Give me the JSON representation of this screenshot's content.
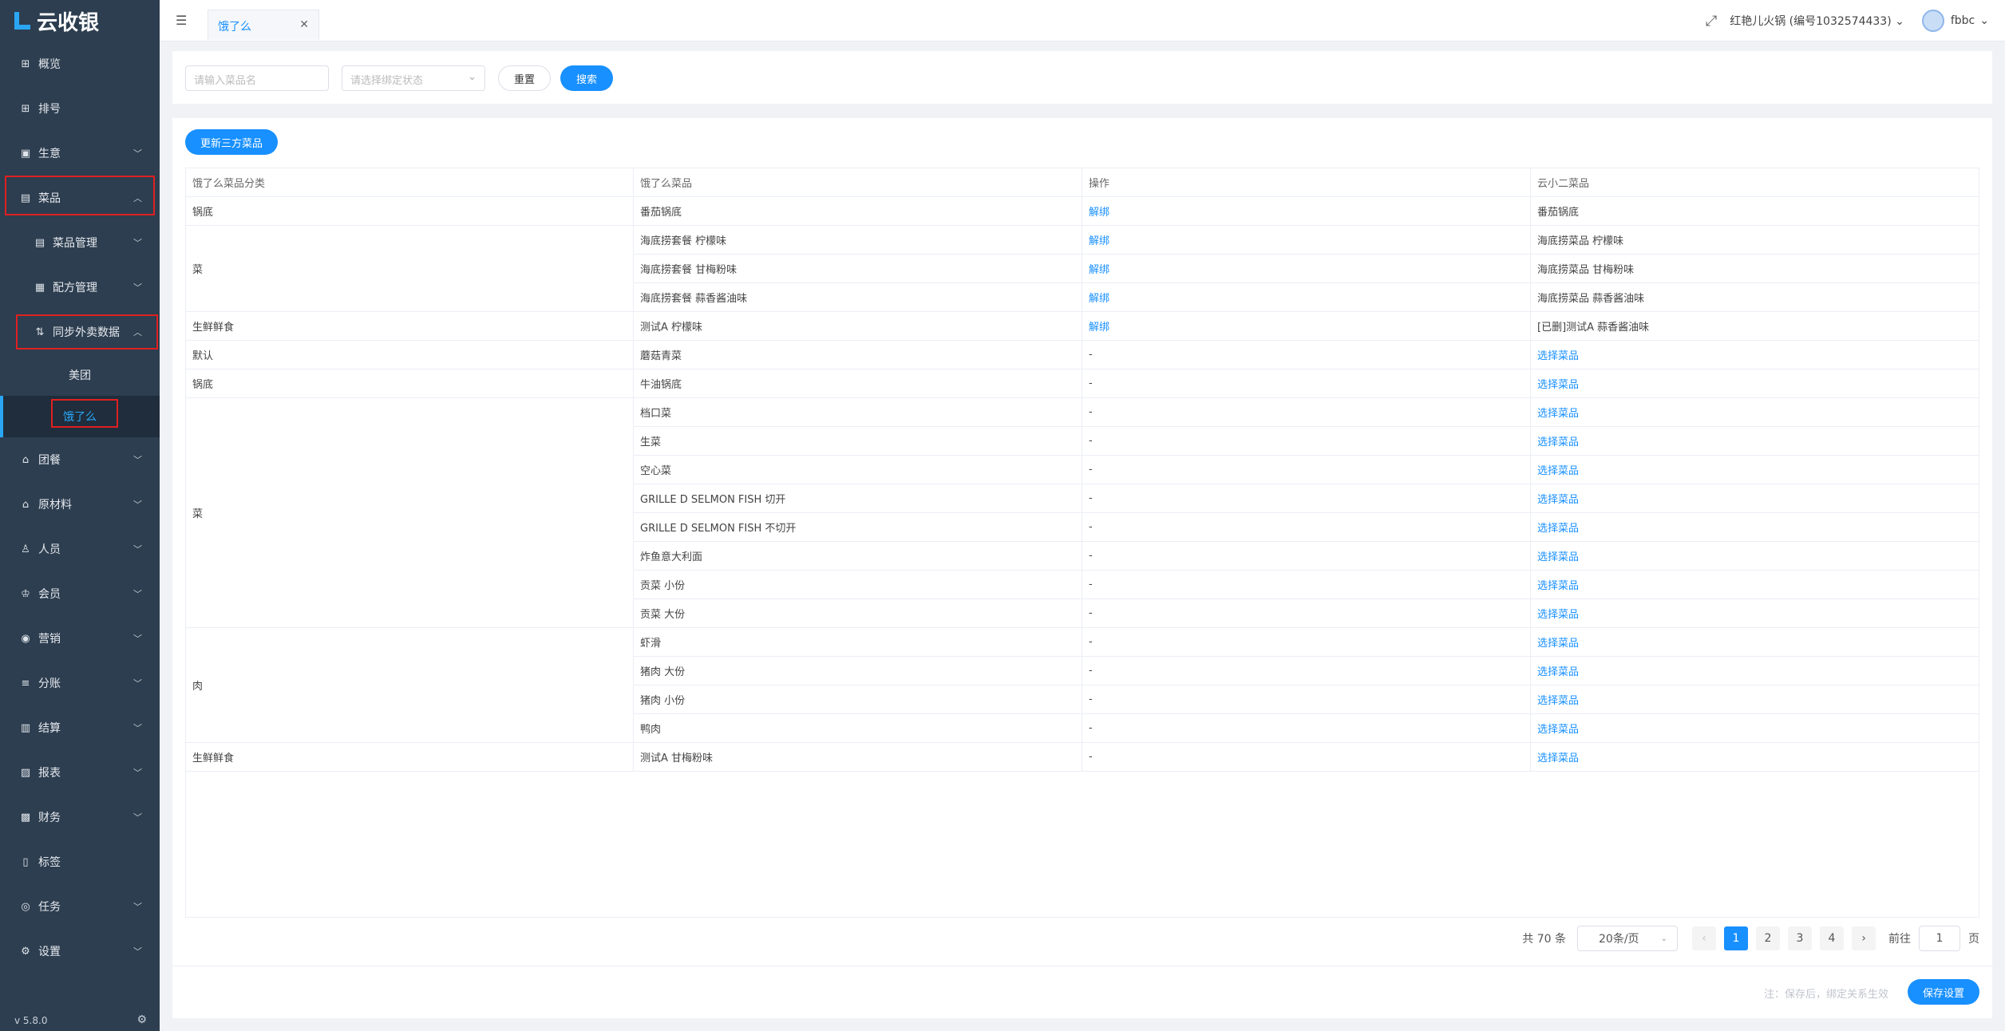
{
  "app": {
    "title": "云收银",
    "version": "v 5.8.0"
  },
  "sidebar": {
    "items": [
      {
        "label": "概览",
        "icon": "overview-icon",
        "glyph": "⊞"
      },
      {
        "label": "排号",
        "icon": "queue-icon",
        "glyph": "⊞"
      },
      {
        "label": "生意",
        "icon": "business-icon",
        "glyph": "▣"
      },
      {
        "label": "菜品",
        "icon": "dish-icon",
        "glyph": "▤"
      },
      {
        "label": "菜品管理",
        "icon": "dish-manage-icon",
        "glyph": "▤"
      },
      {
        "label": "配方管理",
        "icon": "recipe-icon",
        "glyph": "▦"
      },
      {
        "label": "同步外卖数据",
        "icon": "sync-icon",
        "glyph": "⇅"
      },
      {
        "label": "美团"
      },
      {
        "label": "饿了么"
      },
      {
        "label": "团餐",
        "icon": "group-meal-icon",
        "glyph": "⌂"
      },
      {
        "label": "原材料",
        "icon": "material-icon",
        "glyph": "⌂"
      },
      {
        "label": "人员",
        "icon": "staff-icon",
        "glyph": "♙"
      },
      {
        "label": "会员",
        "icon": "member-icon",
        "glyph": "♔"
      },
      {
        "label": "营销",
        "icon": "marketing-icon",
        "glyph": "◉"
      },
      {
        "label": "分账",
        "icon": "split-icon",
        "glyph": "≡"
      },
      {
        "label": "结算",
        "icon": "settle-icon",
        "glyph": "▥"
      },
      {
        "label": "报表",
        "icon": "report-icon",
        "glyph": "▨"
      },
      {
        "label": "财务",
        "icon": "finance-icon",
        "glyph": "▩"
      },
      {
        "label": "标签",
        "icon": "tag-icon",
        "glyph": "▯"
      },
      {
        "label": "任务",
        "icon": "task-icon",
        "glyph": "◎"
      },
      {
        "label": "设置",
        "icon": "settings-icon",
        "glyph": "⚙"
      }
    ]
  },
  "header": {
    "tab_label": "饿了么",
    "store": "红艳儿火锅 (编号1032574433)",
    "user": "fbbc"
  },
  "filters": {
    "dish_placeholder": "请输入菜品名",
    "status_placeholder": "请选择绑定状态",
    "reset_label": "重置",
    "search_label": "搜索"
  },
  "main": {
    "update_button": "更新三方菜品",
    "columns": [
      "饿了么菜品分类",
      "饿了么菜品",
      "操作",
      "云小二菜品"
    ],
    "categories": [
      "锅底",
      "菜",
      "生鲜鲜食",
      "默认",
      "锅底",
      "菜",
      "肉",
      "生鲜鲜食"
    ],
    "dishes": [
      "番茄锅底",
      "海底捞套餐 柠檬味",
      "海底捞套餐 甘梅粉味",
      "海底捞套餐 蒜香酱油味",
      "测试A 柠檬味",
      "蘑菇青菜",
      "牛油锅底",
      "档口菜",
      "生菜",
      "空心菜",
      "GRILLE D SELMON FISH 切开",
      "GRILLE D SELMON FISH 不切开",
      "炸鱼意大利面",
      "贡菜 小份",
      "贡菜 大份",
      "虾滑",
      "猪肉 大份",
      "猪肉 小份",
      "鸭肉",
      "测试A 甘梅粉味"
    ],
    "operations": [
      "解绑",
      "解绑",
      "解绑",
      "解绑",
      "解绑",
      "-",
      "-",
      "-",
      "-",
      "-",
      "-",
      "-",
      "-",
      "-",
      "-",
      "-",
      "-",
      "-",
      "-",
      "-"
    ],
    "yun_dishes": [
      "番茄锅底",
      "海底捞菜品 柠檬味",
      "海底捞菜品 甘梅粉味",
      "海底捞菜品 蒜香酱油味",
      "[已删]测试A 蒜香酱油味",
      "选择菜品",
      "选择菜品",
      "选择菜品",
      "选择菜品",
      "选择菜品",
      "选择菜品",
      "选择菜品",
      "选择菜品",
      "选择菜品",
      "选择菜品",
      "选择菜品",
      "选择菜品",
      "选择菜品",
      "选择菜品",
      "选择菜品"
    ]
  },
  "pagination": {
    "total": "共 70 条",
    "page_size": "20条/页",
    "pages": [
      "1",
      "2",
      "3",
      "4"
    ],
    "goto_label": "前往",
    "goto_value": "1",
    "page_unit": "页"
  },
  "footer": {
    "note": "注：保存后，绑定关系生效",
    "save_label": "保存设置"
  },
  "colors": {
    "accent": "#1890ff",
    "sidebar": "#2d3e50",
    "highlight": "#e02020"
  }
}
